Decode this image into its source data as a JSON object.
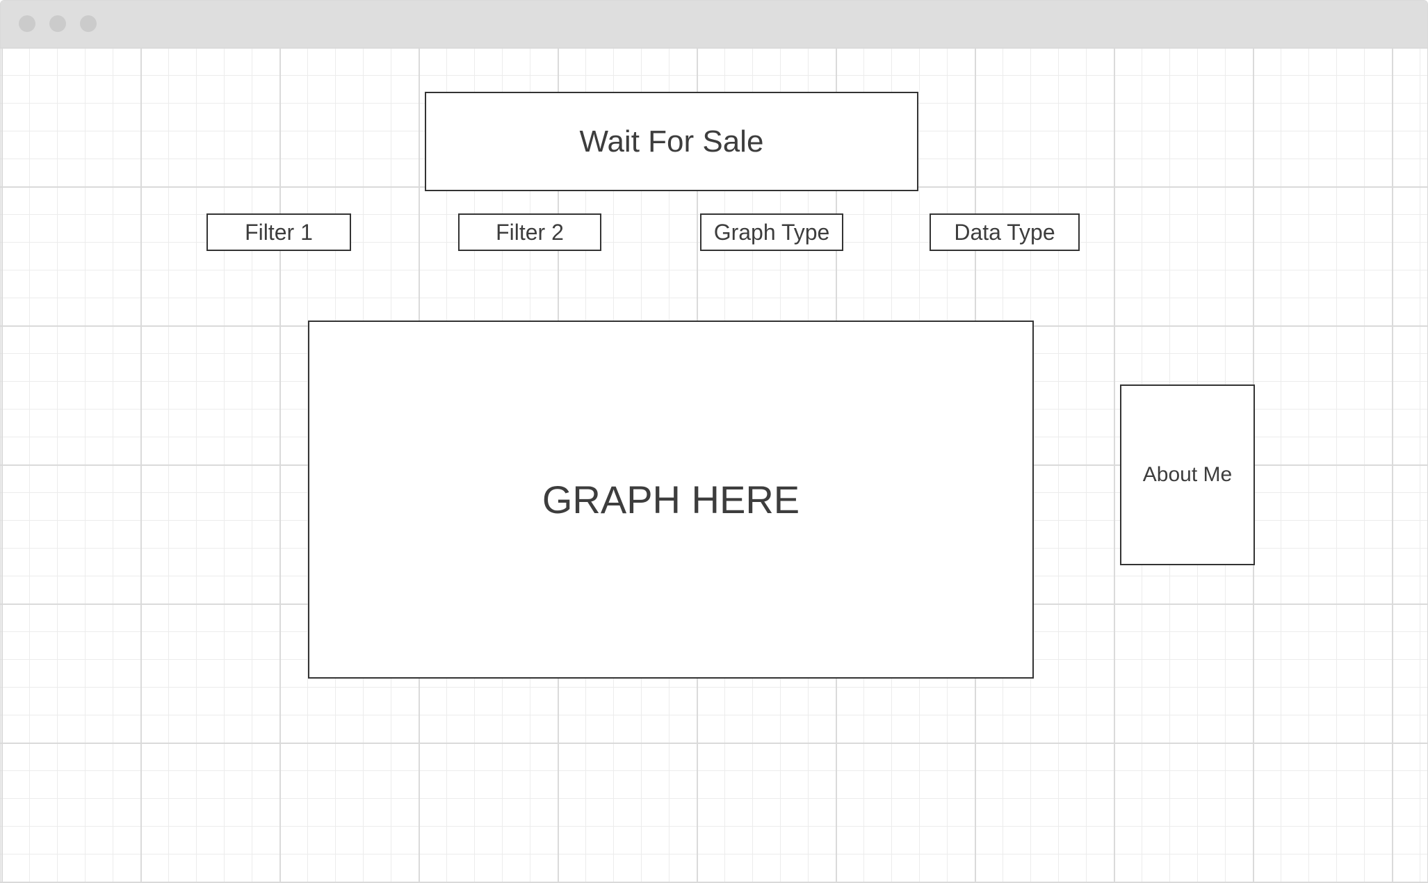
{
  "window": {
    "controls": [
      "close-dot",
      "minimize-dot",
      "zoom-dot"
    ]
  },
  "header": {
    "title": "Wait For Sale"
  },
  "controls": {
    "filter1": "Filter 1",
    "filter2": "Filter 2",
    "graph_type": "Graph Type",
    "data_type": "Data Type"
  },
  "main": {
    "graph_placeholder": "GRAPH HERE"
  },
  "sidebar": {
    "about": "About Me"
  },
  "colors": {
    "titlebar": "#dedede",
    "border": "#333333",
    "text": "#3d3d3d",
    "grid_major": "#dadada",
    "grid_minor": "#ececec"
  }
}
